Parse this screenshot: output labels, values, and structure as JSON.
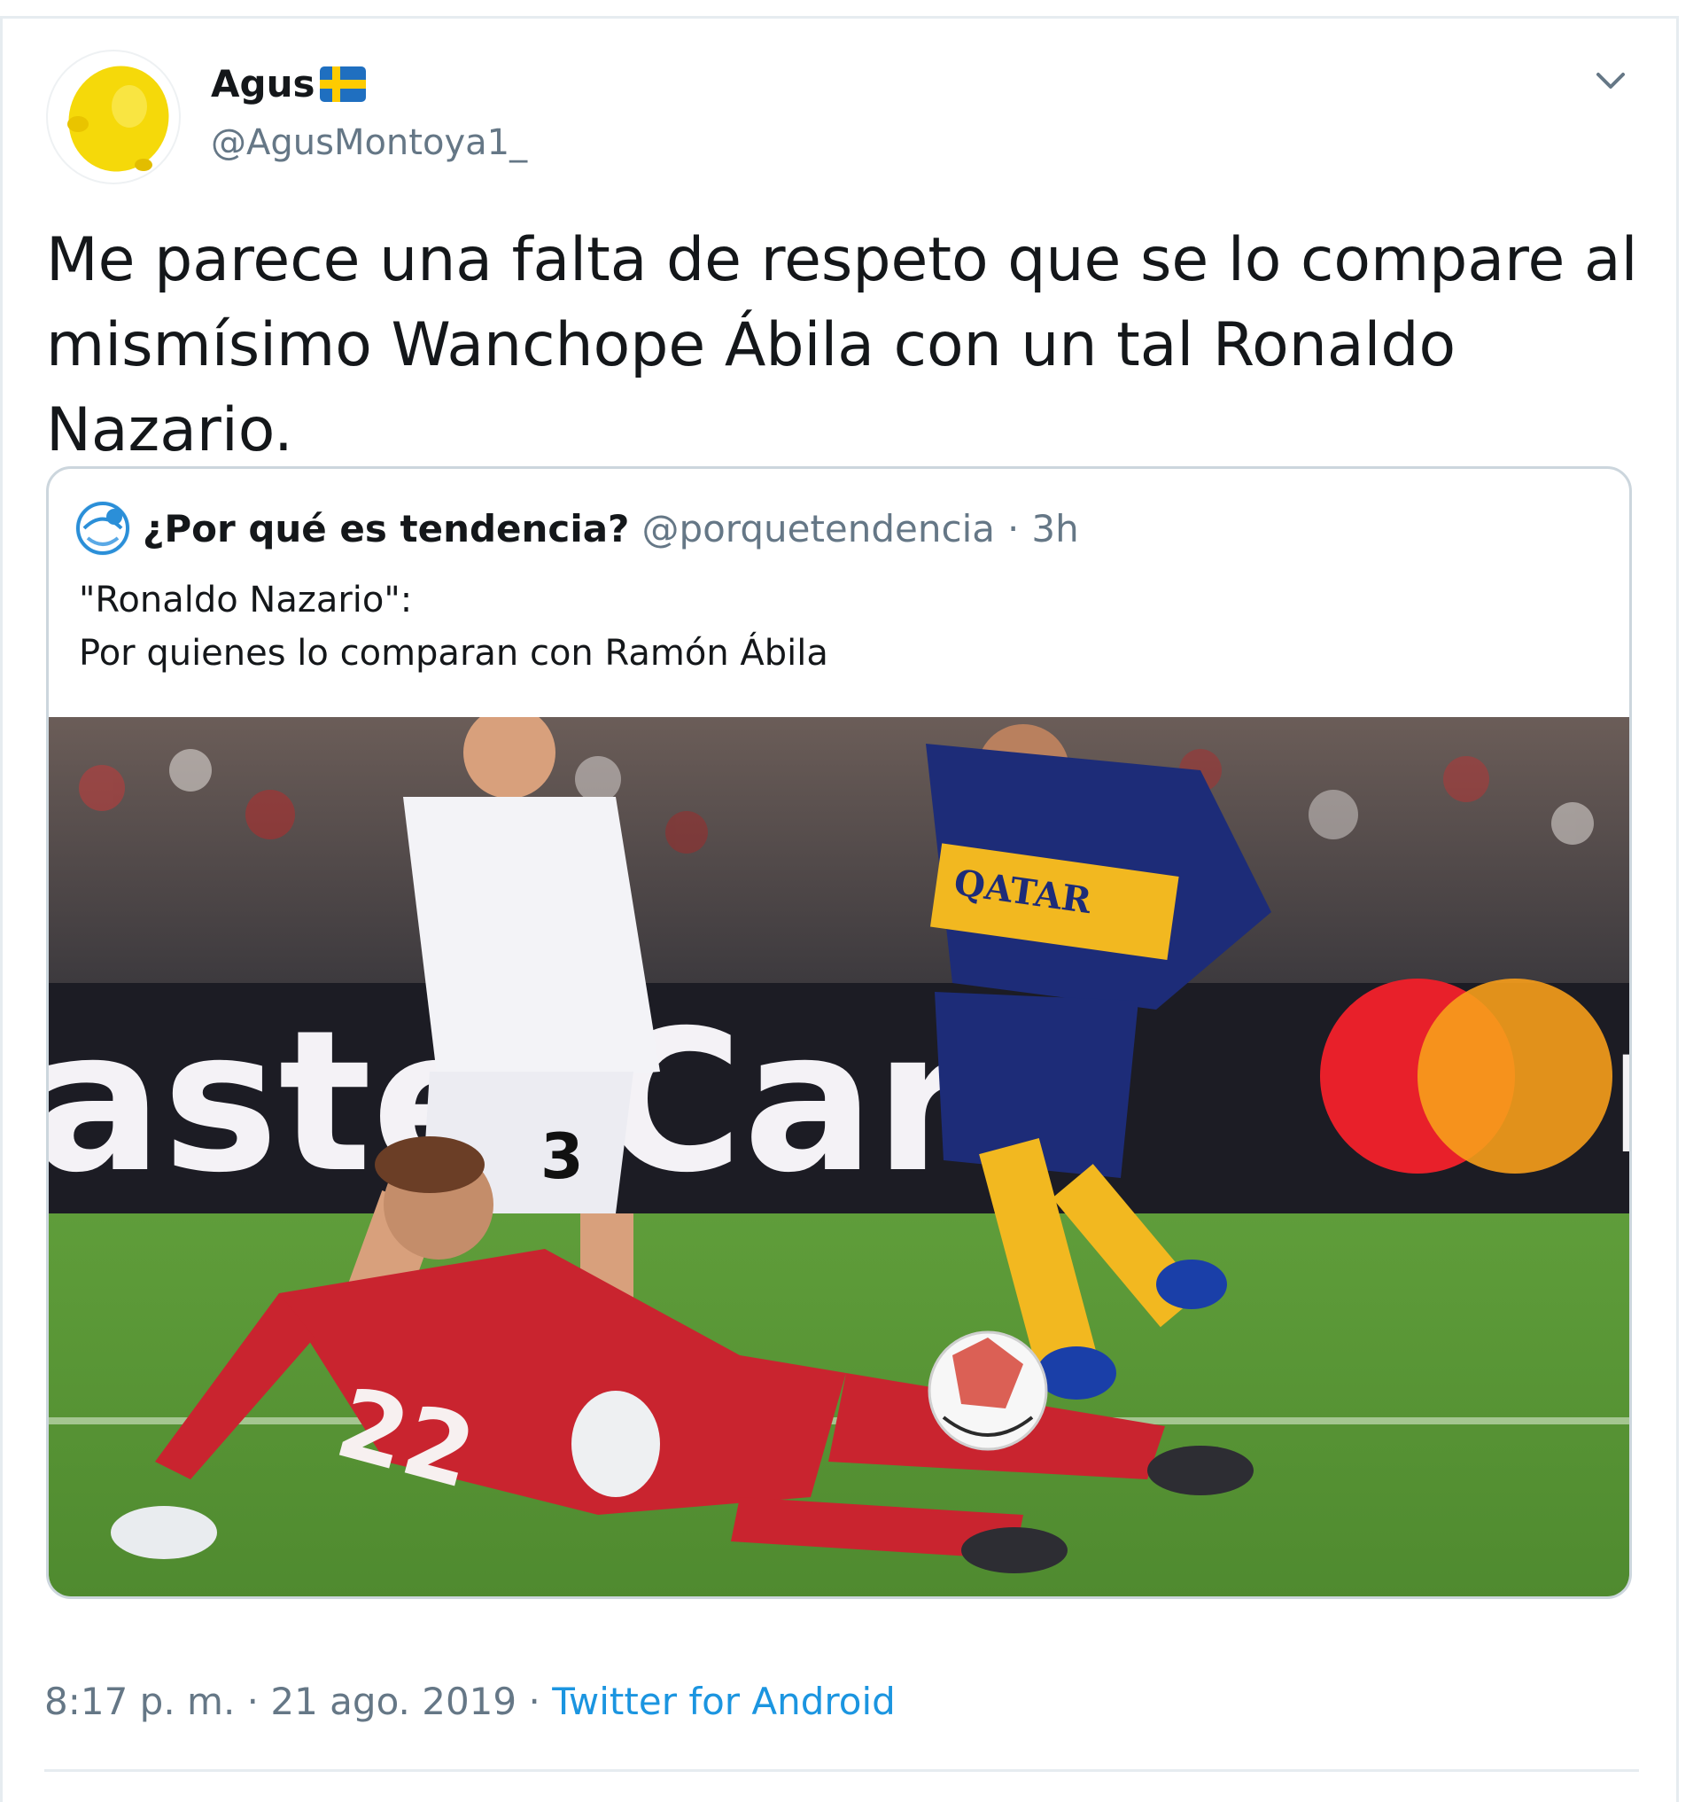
{
  "author": {
    "display_name": "Agus",
    "flag_icon": "sweden-flag-icon",
    "handle": "@AgusMontoya1_",
    "avatar_icon": "lemon-avatar"
  },
  "tweet": {
    "text": "Me parece una falta de respeto que se lo compare al mismísimo Wanchope Ábila con un tal Ronaldo Nazario."
  },
  "quoted_tweet": {
    "display_name": "¿Por qué es tendencia?",
    "handle": "@porquetendencia",
    "separator": "·",
    "time": "3h",
    "line1": "\"Ronaldo Nazario\":",
    "line2": "Por quienes lo comparan con Ramón Ábila",
    "image_alt": "football-match-photo"
  },
  "footer": {
    "time": "8:17 p. m.",
    "sep1": "·",
    "date": "21 ago. 2019",
    "sep2": "·",
    "source": "Twitter for Android"
  },
  "colors": {
    "accent": "#1b95e0",
    "secondary_text": "#657786",
    "border": "#ccd6dd"
  }
}
